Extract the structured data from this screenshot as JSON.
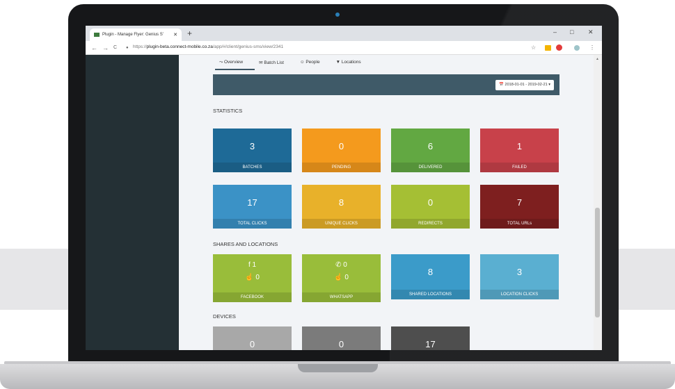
{
  "browser": {
    "tab_title": "Plugin - Manage Flyer: Genius S’",
    "tab_close": "✕",
    "new_tab": "+",
    "url_prefix": "https://",
    "url_domain": "plugin-beta.connect-mobile.co.za",
    "url_path": "/app/#/client/genius-sms/view/2341",
    "back": "←",
    "forward": "→",
    "reload": "C",
    "minimize": "–",
    "maximize": "□",
    "close": "✕",
    "star": "☆",
    "menu": "⋮"
  },
  "tabs": [
    {
      "label": "⤳ Overview"
    },
    {
      "label": "✉ Batch List"
    },
    {
      "label": "☺ People"
    },
    {
      "label": "▼ Locations"
    }
  ],
  "date_range": "2018-01-01 - 2019-02-21 ▾",
  "statistics": {
    "title": "STATISTICS",
    "tiles": [
      {
        "value": "3",
        "label": "BATCHES",
        "color": "#1e6a97"
      },
      {
        "value": "0",
        "label": "PENDING",
        "color": "#f49a1d"
      },
      {
        "value": "6",
        "label": "DELIVERED",
        "color": "#62a842"
      },
      {
        "value": "1",
        "label": "FAILED",
        "color": "#c8414a"
      },
      {
        "value": "17",
        "label": "TOTAL CLICKS",
        "color": "#3b92c6"
      },
      {
        "value": "8",
        "label": "UNIQUE CLICKS",
        "color": "#e8b12a"
      },
      {
        "value": "0",
        "label": "REDIRECTS",
        "color": "#a5bf34"
      },
      {
        "value": "7",
        "label": "TOTAL URLs",
        "color": "#7e1f1f"
      }
    ]
  },
  "shares": {
    "title": "SHARES AND LOCATIONS",
    "facebook": {
      "line1": "f 1",
      "line2": "☝ 0",
      "label": "FACEBOOK",
      "color": "#99bd3a"
    },
    "whatsapp": {
      "line1": "✆ 0",
      "line2": "☝ 0",
      "label": "WHATSAPP",
      "color": "#99bd3a"
    },
    "shared_locations": {
      "value": "8",
      "label": "SHARED LOCATIONS",
      "color": "#3b9bc9"
    },
    "location_clicks": {
      "value": "3",
      "label": "LOCATION CLICKS",
      "color": "#5aafd1"
    }
  },
  "devices": {
    "title": "DEVICES",
    "tiles": [
      {
        "value": "0",
        "color": "#a8a8a8"
      },
      {
        "value": "0",
        "color": "#7b7b7b"
      },
      {
        "value": "17",
        "color": "#4e4e4e"
      }
    ]
  }
}
